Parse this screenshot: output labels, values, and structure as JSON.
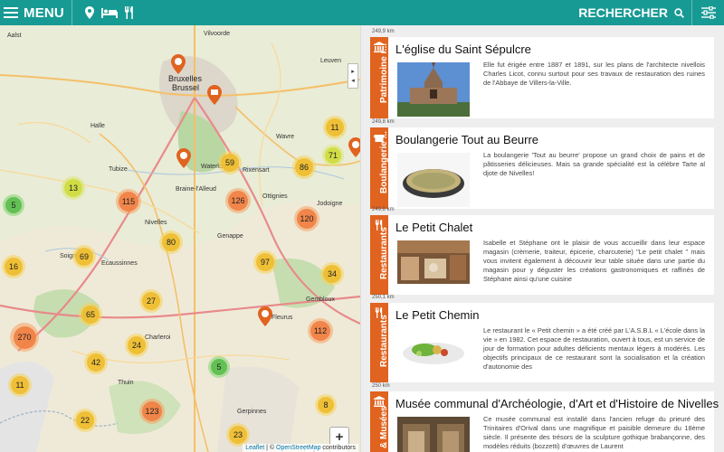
{
  "topbar": {
    "menu_label": "MENU",
    "search_label": "RECHERCHER",
    "icons": [
      "map-pin-icon",
      "bed-icon",
      "fork-knife-icon",
      "search-icon",
      "sliders-icon"
    ],
    "accent": "#179a94"
  },
  "map": {
    "towns": [
      {
        "label": "Vilvoorde",
        "big": false
      },
      {
        "label": "Aalst",
        "big": false
      },
      {
        "label": "Bruxelles",
        "big": true
      },
      {
        "label": "Brussel",
        "big": true
      },
      {
        "label": "Leuven",
        "big": false
      },
      {
        "label": "Halle",
        "big": false
      },
      {
        "label": "Waterloo",
        "big": false
      },
      {
        "label": "Wavre",
        "big": false
      },
      {
        "label": "Nivelles",
        "big": false
      },
      {
        "label": "Ottignies",
        "big": false
      },
      {
        "label": "Genappe",
        "big": false
      },
      {
        "label": "Gembloux",
        "big": false
      },
      {
        "label": "Soignies",
        "big": false
      },
      {
        "label": "Fleurus",
        "big": false
      },
      {
        "label": "Charleroi",
        "big": false
      },
      {
        "label": "Braine-l'Alleud",
        "big": false
      },
      {
        "label": "Rixensart",
        "big": false
      },
      {
        "label": "Ecaussinnes",
        "big": false
      },
      {
        "label": "Tubize",
        "big": false
      },
      {
        "label": "Jodoigne",
        "big": false
      },
      {
        "label": "Thuin",
        "big": false
      },
      {
        "label": "Gerpinnes",
        "big": false
      }
    ],
    "clusters": [
      "11",
      "71",
      "13",
      "115",
      "59",
      "126",
      "86",
      "120",
      "16",
      "69",
      "80",
      "97",
      "34",
      "27",
      "65",
      "112",
      "270",
      "24",
      "42",
      "5",
      "5",
      "11",
      "22",
      "123",
      "23",
      "8"
    ],
    "cluster_colors": {
      "small": "#cedb3c",
      "medium": "#eebe32",
      "large": "#f08246",
      "green": "#5fbe50"
    },
    "pin_color": "#e0631f",
    "zoom_in": "+",
    "zoom_out": "−",
    "attribution": {
      "leaflet": "Leaflet",
      "sep": " | © ",
      "osm": "OpenStreetMap",
      "contrib": " contributors"
    }
  },
  "list": {
    "category_color": "#e0631f",
    "items": [
      {
        "distance": "249,9 km",
        "category": "Patrimoine r...",
        "category_icon": "building-icon",
        "title": "L'église du Saint Sépulcre",
        "description": "Elle fut érigée entre 1887 et 1891, sur les plans de l'architecte nivellois Charles Licot, connu surtout pour ses travaux de restauration des ruines de l'Abbaye de Villers-la-Ville."
      },
      {
        "distance": "249,8 km",
        "category": "Boulangerie ...",
        "category_icon": "bread-icon",
        "title": "Boulangerie Tout au Beurre",
        "description": "La boulangerie 'Tout au beurre' propose un grand choix de pains et de pâtisseries délicieuses. Mais sa grande spécialité est la célèbre Tarte al djote de Nivelles!"
      },
      {
        "distance": "249,8 km",
        "category": "Restaurants",
        "category_icon": "fork-knife-icon",
        "title": "Le Petit Chalet",
        "description": "Isabelle et Stéphane ont le plaisir de vous accueillir dans leur espace magasin (crèmerie, traiteur, épicerie, charcuterie) \"Le petit chalet \" mais vous invitent également à découvrir leur table située dans une partie du magasin pour y déguster les créations gastronomiques et raffinés de Stéphane ainsi qu'une cuisine"
      },
      {
        "distance": "250,1 km",
        "category": "Restaurants",
        "category_icon": "fork-knife-icon",
        "title": "Le Petit Chemin",
        "description": "Le restaurant le « Petit chemin » a été créé par L'A.S.B.L « L'école dans la vie » en 1982. Cet espace de restauration, ouvert à tous, est un service de jour de formation pour adultes déficients mentaux légers à modérés. Les objectifs principaux de ce restaurant sont la socialisation et la création d'autonomie des"
      },
      {
        "distance": "250 km",
        "category": "& Musées",
        "category_icon": "building-icon",
        "title": "Musée communal d'Archéologie, d'Art et d'Histoire de Nivelles",
        "description": "Ce musée communal est installé dans l'ancien refuge du prieuré des Trinitaires d'Orival dans une magnifique et paisible demeure du 18ème siècle. Il présente des trésors de la sculpture gothique brabançonne, des modèles réduits (bozzetti) d'œuvres de Laurent"
      }
    ]
  }
}
